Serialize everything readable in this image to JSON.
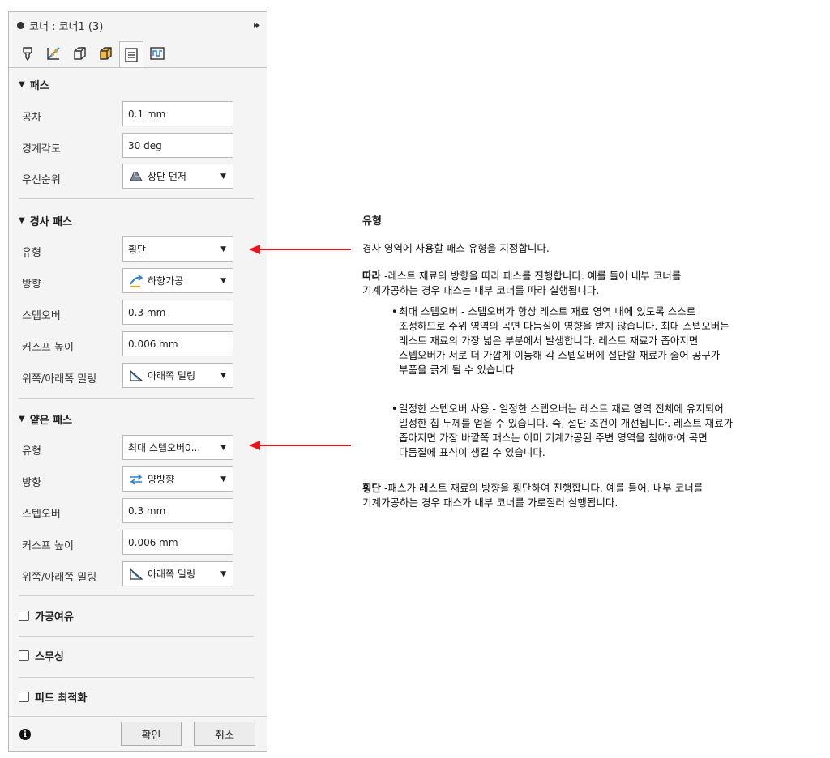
{
  "dialog": {
    "title": "코너 : 코너1 (3)",
    "expand_glyph": "▸▸",
    "tabs": [
      {
        "name": "tool-tab",
        "icon": "tool-icon"
      },
      {
        "name": "geometry-tab",
        "icon": "geometry-icon"
      },
      {
        "name": "heights-tab",
        "icon": "heights-icon"
      },
      {
        "name": "stock-tab",
        "icon": "stock-icon"
      },
      {
        "name": "passes-tab",
        "icon": "passes-icon",
        "active": true
      },
      {
        "name": "linking-tab",
        "icon": "linking-icon"
      }
    ]
  },
  "passes": {
    "header": "패스",
    "tolerance": {
      "label": "공차",
      "value": "0.1 mm"
    },
    "boundary_angle": {
      "label": "경계각도",
      "value": "30 deg"
    },
    "priority": {
      "label": "우선순위",
      "value": "상단 먼저",
      "icon": "top-first-icon"
    }
  },
  "steep_passes": {
    "header": "경사 패스",
    "type": {
      "label": "유형",
      "value": "횡단"
    },
    "direction": {
      "label": "방향",
      "value": "하향가공",
      "icon": "climb-icon"
    },
    "stepover": {
      "label": "스텝오버",
      "value": "0.3 mm"
    },
    "cusp_height": {
      "label": "커스프 높이",
      "value": "0.006 mm"
    },
    "milling": {
      "label": "위쪽/아래쪽 밀링",
      "value": "아래쪽 밀링",
      "icon": "down-milling-icon"
    }
  },
  "shallow_passes": {
    "header": "얕은 패스",
    "type": {
      "label": "유형",
      "value": "최대 스텝오버0..."
    },
    "direction": {
      "label": "방향",
      "value": "양방향",
      "icon": "both-ways-icon"
    },
    "stepover": {
      "label": "스텝오버",
      "value": "0.3 mm"
    },
    "cusp_height": {
      "label": "커스프 높이",
      "value": "0.006 mm"
    },
    "milling": {
      "label": "위쪽/아래쪽 밀링",
      "value": "아래쪽 밀링",
      "icon": "down-milling-icon"
    }
  },
  "options": {
    "stock_to_leave": "가공여유",
    "smoothing": "스무싱",
    "feed_optimization": "피드 최적화"
  },
  "footer": {
    "ok": "확인",
    "cancel": "취소"
  },
  "help": {
    "title": "유형",
    "intro": "경사 영역에 사용할 패스 유형을 지정합니다.",
    "along_term": "따라",
    "along_line1": " -레스트 재료의 방향을 따라 패스를 진행합니다. 예를 들어 내부 코너를",
    "along_line2": "기계가공하는 경우 패스는 내부 코너를 따라 실행됩니다.",
    "bullet1": [
      "최대 스텝오버 - 스텝오버가 항상 레스트 재료 영역 내에 있도록 스스로",
      "조정하므로 주위 영역의 곡면 다듬질이 영향을 받지 않습니다. 최대 스텝오버는",
      "레스트 재료의 가장 넓은 부분에서 발생합니다. 레스트 재료가 좁아지면",
      "스텝오버가 서로 더 가깝게 이동해 각 스텝오버에 절단할 재료가 줄어 공구가",
      "부품을 긁게 될 수 있습니다"
    ],
    "bullet2": [
      "일정한 스텝오버 사용 - 일정한 스텝오버는 레스트 재료 영역 전체에 유지되어",
      "일정한 칩 두께를 얻을 수 있습니다. 즉, 절단 조건이 개선됩니다. 레스트 재료가",
      "좁아지면 가장 바깥쪽 패스는 이미 기계가공된 주변 영역을 침해하여 곡면",
      "다듬질에 표식이 생길 수 있습니다."
    ],
    "across_term": "횡단",
    "across_line1": " -패스가 레스트 재료의 방향을 횡단하여 진행합니다. 예를 들어, 내부 코너를",
    "across_line2": "기계가공하는 경우 패스가 내부 코너를 가로질러 실행됩니다."
  },
  "colors": {
    "arrow": "#e8141b",
    "panel_bg": "#f4f4f4",
    "accent_blue": "#2f7fd0"
  }
}
